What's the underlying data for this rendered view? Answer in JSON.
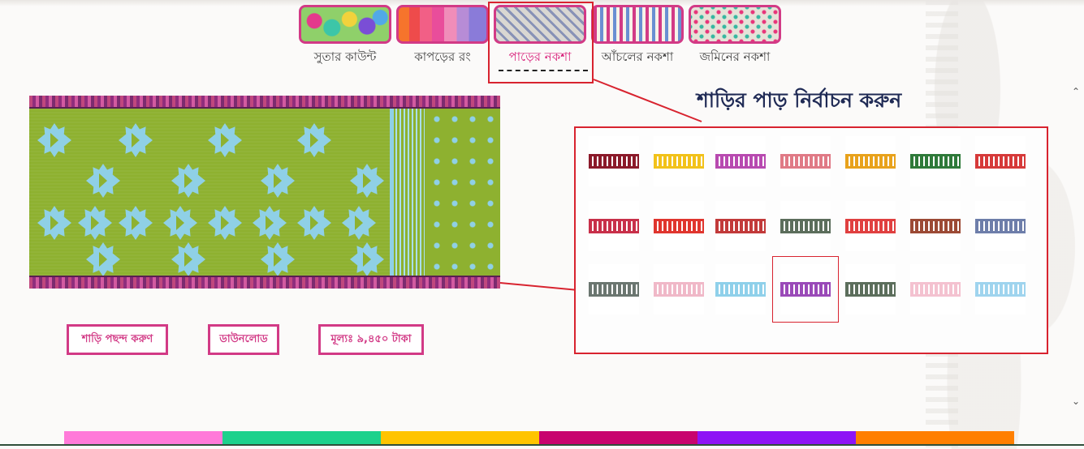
{
  "tabs": [
    {
      "label": "সুতার কাউন্ট",
      "thumb": "yarn"
    },
    {
      "label": "কাপড়ের রং",
      "thumb": "fabric"
    },
    {
      "label": "পাড়ের নকশা",
      "thumb": "border",
      "active": true
    },
    {
      "label": "আঁচলের নকশা",
      "thumb": "anchal"
    },
    {
      "label": "জমিনের নকশা",
      "thumb": "body"
    }
  ],
  "heading": "শাড়ির পাড় নির্বাচন করুন",
  "actions": {
    "choose": "শাড়ি পছন্দ করুণ",
    "download": "ডাউনলোড",
    "price": "মূল্যঃ ৯,৪৫০ টাকা"
  },
  "palette": {
    "selected_index": 17,
    "swatches": [
      "#8b1a2a",
      "#f2c21a",
      "#b84ab0",
      "#e07a86",
      "#e8a21c",
      "#2f7a3a",
      "#d63a3a",
      "#c8304a",
      "#e0352e",
      "#c23a3a",
      "#5c6e5c",
      "#e04040",
      "#9c4a35",
      "#6e7eaa",
      "#6b7670",
      "#f0b8c8",
      "#8fd0ea",
      "#9a4ab8",
      "#5c6e5c",
      "#f4c2d0",
      "#9fd4ee"
    ]
  },
  "colors": {
    "accent": "#d23a86",
    "highlight": "#d8232f",
    "heading": "#1f2a55",
    "color_bar": [
      "#ff7ad9",
      "#1dd18c",
      "#ffc400",
      "#c8046e",
      "#8e14f5",
      "#ff7f00"
    ]
  },
  "icons": {
    "scroll_up": "chevron-up-icon",
    "scroll_down": "chevron-down-icon"
  }
}
